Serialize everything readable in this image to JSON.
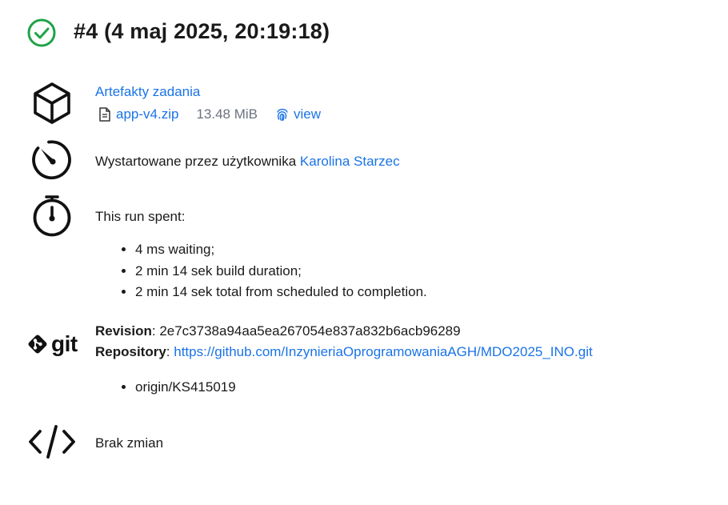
{
  "header": {
    "title": "#4 (4 maj 2025, 20:19:18)",
    "status_color": "#1ea446"
  },
  "artifacts": {
    "heading": "Artefakty zadania",
    "file_name": "app-v4.zip",
    "file_size": "13.48 MiB",
    "view_label": "view",
    "icon": "cube-icon"
  },
  "started_by": {
    "prefix": "Wystartowane przez użytkownika",
    "user": "Karolina Starzec",
    "icon": "gauge-icon"
  },
  "timing": {
    "heading": "This run spent:",
    "items": [
      "4 ms waiting;",
      "2 min 14 sek build duration;",
      "2 min 14 sek total from scheduled to completion."
    ],
    "icon": "stopwatch-icon"
  },
  "git": {
    "logo_text": "git",
    "revision_label": "Revision",
    "revision_value": "2e7c3738a94aa5ea267054e837a832b6acb96289",
    "repository_label": "Repository",
    "repository_url": "https://github.com/InzynieriaOprogramowaniaAGH/MDO2025_INO.git",
    "branches": [
      "origin/KS415019"
    ],
    "icon": "git-logo-icon"
  },
  "changes": {
    "text": "Brak zmian",
    "icon": "code-icon"
  },
  "colors": {
    "link": "#1a73e8",
    "text": "#1a1a1a",
    "success": "#1ea446"
  }
}
